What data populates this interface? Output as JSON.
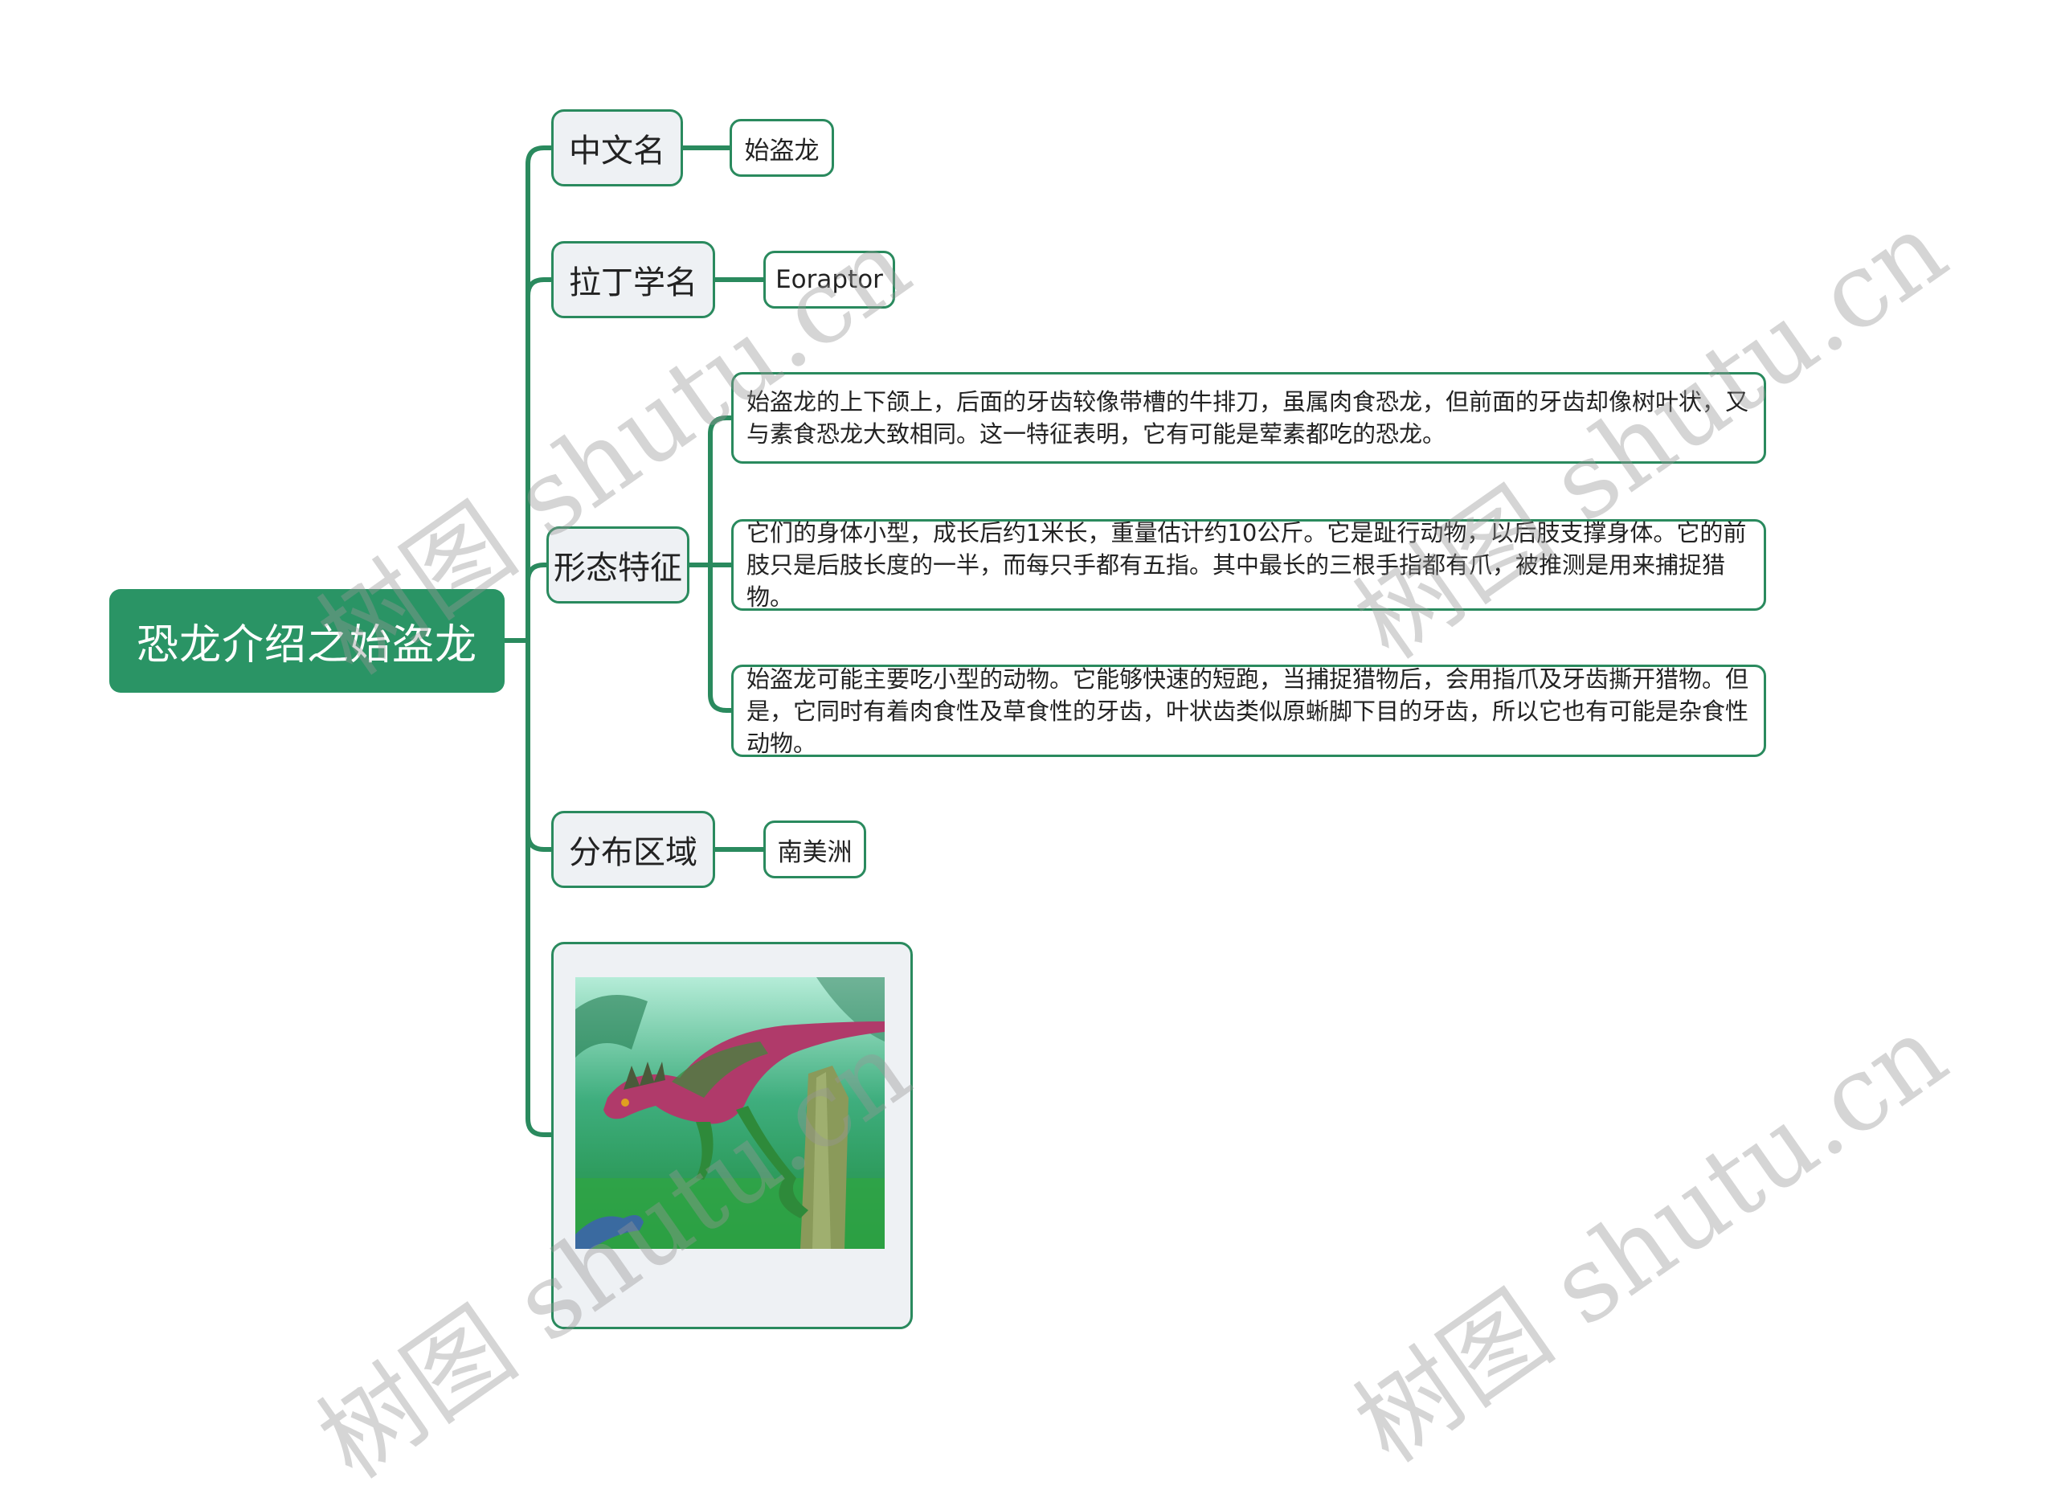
{
  "root": {
    "label": "恐龙介绍之始盗龙"
  },
  "branches": [
    {
      "label": "中文名",
      "children": [
        "始盗龙"
      ]
    },
    {
      "label": "拉丁学名",
      "children": [
        "Eoraptor"
      ]
    },
    {
      "label": "形态特征",
      "children": [
        "始盗龙的上下颌上，后面的牙齿较像带槽的牛排刀，虽属肉食恐龙，但前面的牙齿却像树叶状，又与素食恐龙大致相同。这一特征表明，它有可能是荤素都吃的恐龙。",
        "它们的身体小型，成长后约1米长，重量估计约10公斤。它是趾行动物，以后肢支撑身体。它的前肢只是后肢长度的一半，而每只手都有五指。其中最长的三根手指都有爪，被推测是用来捕捉猎物。",
        "始盗龙可能主要吃小型的动物。它能够快速的短跑，当捕捉猎物后，会用指爪及牙齿撕开猎物。但是，它同时有着肉食性及草食性的牙齿，叶状齿类似原蜥脚下目的牙齿，所以它也有可能是杂食性动物。"
      ]
    },
    {
      "label": "分布区域",
      "children": [
        "南美洲"
      ]
    }
  ],
  "image_node": {
    "alt": "始盗龙插图：雨林中的彩色条纹小型恐龙"
  },
  "watermark": "树图 shutu.cn",
  "colors": {
    "accent": "#2a9465",
    "line": "#2a8a5e",
    "node_bg": "#eef1f4"
  }
}
